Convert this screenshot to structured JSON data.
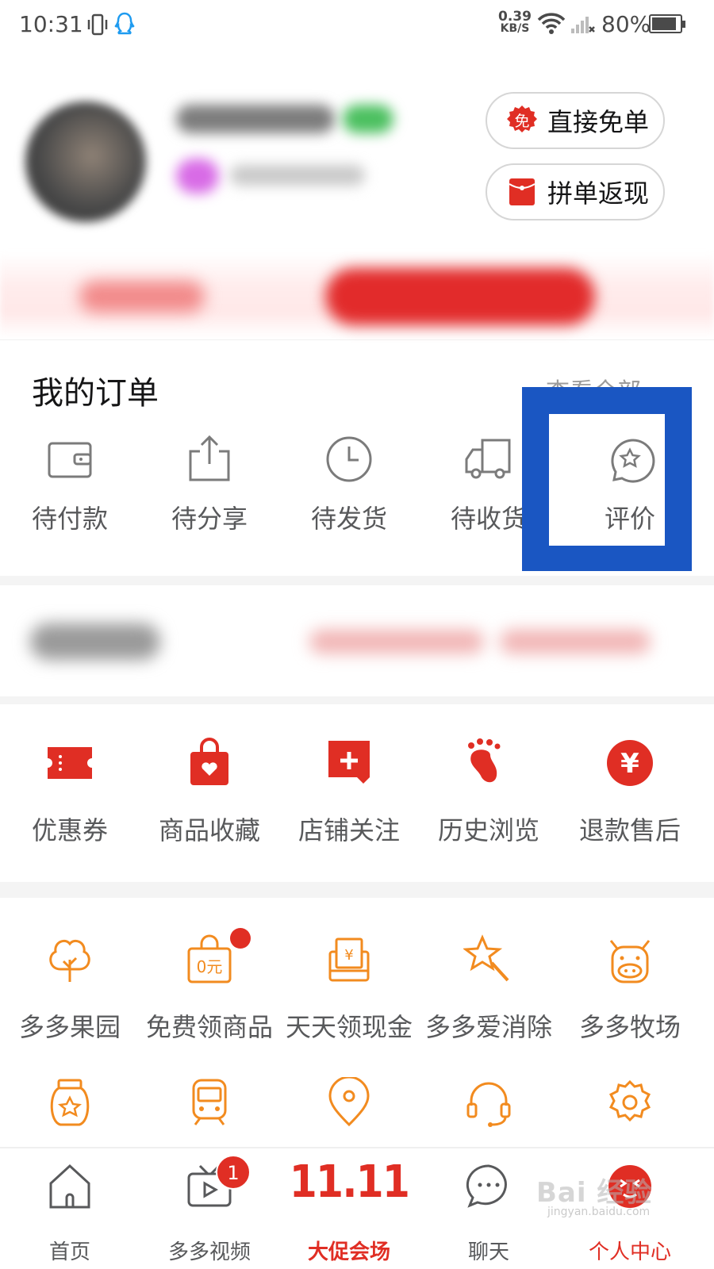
{
  "status_bar": {
    "time": "10:31",
    "net_speed_value": "0.39",
    "net_speed_unit": "KB/S",
    "battery": "80%"
  },
  "profile": {
    "buttons": [
      {
        "label": "直接免单",
        "icon": "free-order-icon",
        "icon_text": "免"
      },
      {
        "label": "拼单返现",
        "icon": "red-envelope-icon"
      }
    ]
  },
  "orders": {
    "title": "我的订单",
    "view_all": "查看全部",
    "items": [
      {
        "label": "待付款",
        "icon": "wallet-icon"
      },
      {
        "label": "待分享",
        "icon": "share-icon"
      },
      {
        "label": "待发货",
        "icon": "clock-icon"
      },
      {
        "label": "待收货",
        "icon": "truck-icon"
      },
      {
        "label": "评价",
        "icon": "review-star-icon"
      }
    ]
  },
  "services": [
    {
      "label": "优惠券",
      "icon": "coupon-icon"
    },
    {
      "label": "商品收藏",
      "icon": "favorite-bag-icon"
    },
    {
      "label": "店铺关注",
      "icon": "store-follow-icon"
    },
    {
      "label": "历史浏览",
      "icon": "footprint-icon"
    },
    {
      "label": "退款售后",
      "icon": "refund-yen-icon",
      "icon_text": "¥"
    }
  ],
  "games": [
    {
      "label": "多多果园",
      "icon": "tree-icon"
    },
    {
      "label": "免费领商品",
      "icon": "free-bag-icon",
      "icon_text": "0元"
    },
    {
      "label": "天天领现金",
      "icon": "cash-envelope-icon",
      "icon_text": "¥"
    },
    {
      "label": "多多爱消除",
      "icon": "star-wand-icon"
    },
    {
      "label": "多多牧场",
      "icon": "cow-icon"
    }
  ],
  "more_icons": [
    "honey-jar-icon",
    "train-icon",
    "location-pin-icon",
    "headset-icon",
    "settings-gear-icon"
  ],
  "tabbar": {
    "tabs": [
      {
        "label": "首页",
        "icon": "home-icon"
      },
      {
        "label": "多多视频",
        "icon": "video-icon",
        "badge": "1"
      },
      {
        "label": "大促会场",
        "icon": "double-eleven-logo",
        "logo_text": "11.11"
      },
      {
        "label": "聊天",
        "icon": "chat-icon"
      },
      {
        "label": "个人中心",
        "icon": "profile-face-icon"
      }
    ]
  },
  "watermark": {
    "text": "Bai 经验",
    "sub": "jingyan.baidu.com"
  },
  "colors": {
    "brand_red": "#e02e24",
    "orange": "#f28b1f",
    "highlight_blue": "#1a56c2",
    "text_primary": "#151516",
    "text_secondary": "#58595b"
  }
}
